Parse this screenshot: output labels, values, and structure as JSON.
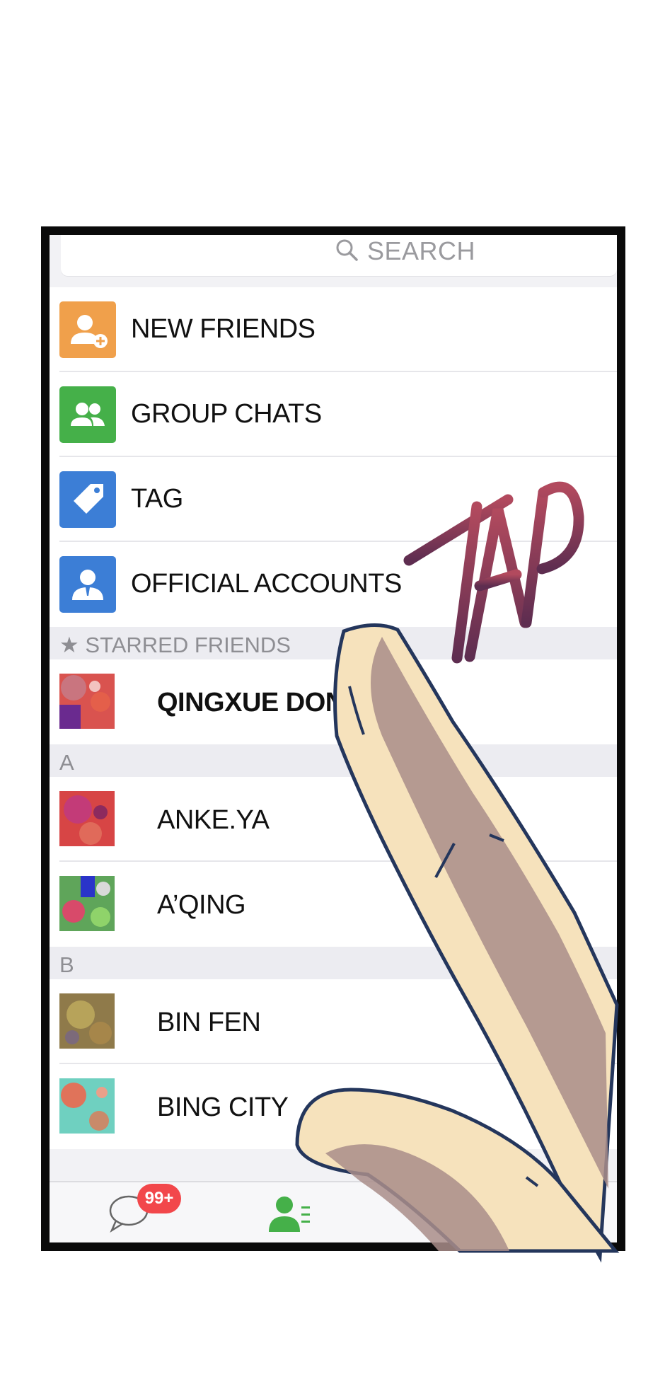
{
  "search": {
    "placeholder": "SEARCH",
    "icon": "search-icon"
  },
  "menu": [
    {
      "label": "NEW FRIENDS",
      "icon": "add-user-icon",
      "color": "#f0a04b"
    },
    {
      "label": "GROUP CHATS",
      "icon": "group-icon",
      "color": "#45b049"
    },
    {
      "label": "TAG",
      "icon": "tag-icon",
      "color": "#3c7ed6"
    },
    {
      "label": "OFFICIAL ACCOUNTS",
      "icon": "official-account-icon",
      "color": "#3c7ed6"
    }
  ],
  "starred": {
    "header": "STARRED FRIENDS",
    "contacts": [
      {
        "name": "QINGXUE DON"
      }
    ]
  },
  "sections": [
    {
      "letter": "A",
      "contacts": [
        {
          "name": "ANKE.YA"
        },
        {
          "name": "A’QING"
        }
      ]
    },
    {
      "letter": "B",
      "contacts": [
        {
          "name": "BIN FEN"
        },
        {
          "name": "BING CITY"
        }
      ]
    }
  ],
  "tabbar": {
    "chats_badge": "99+",
    "tabs": [
      {
        "icon": "chat-bubble-icon"
      },
      {
        "icon": "contacts-icon",
        "active": true
      }
    ],
    "active_color": "#45b049",
    "badge_color": "#f2474b"
  },
  "overlay": {
    "lettering": "TAP",
    "lettering_color": "#8a3a55"
  }
}
